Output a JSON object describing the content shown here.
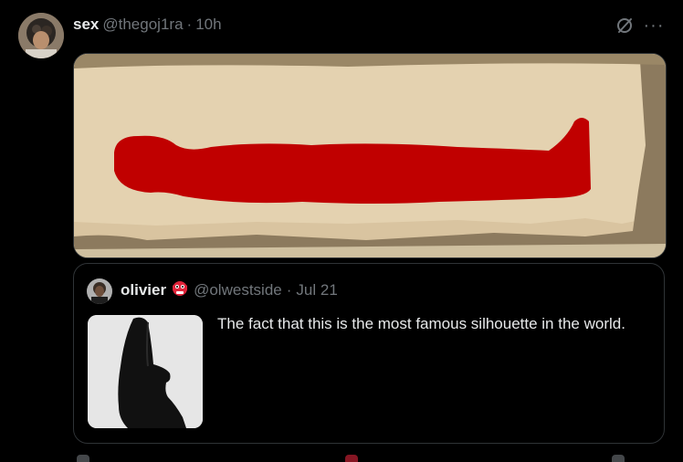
{
  "post": {
    "display_name": "sex",
    "handle": "@thegoj1ra",
    "separator": "·",
    "time": "10h",
    "more_label": "···"
  },
  "quote": {
    "display_name": "olivier",
    "handle": "@olwestside",
    "separator": "·",
    "date": "Jul 21",
    "text": "The fact that this is the most famous silhouette in the world."
  },
  "icons": {
    "grok": "grok-icon",
    "more": "more-icon",
    "badge": "goblin-emoji-icon"
  },
  "colors": {
    "background": "#000000",
    "text": "#e7e9ea",
    "muted": "#71767b",
    "border": "#2f3336",
    "figure_red": "#c00000",
    "sand": "#d9c4a0"
  }
}
